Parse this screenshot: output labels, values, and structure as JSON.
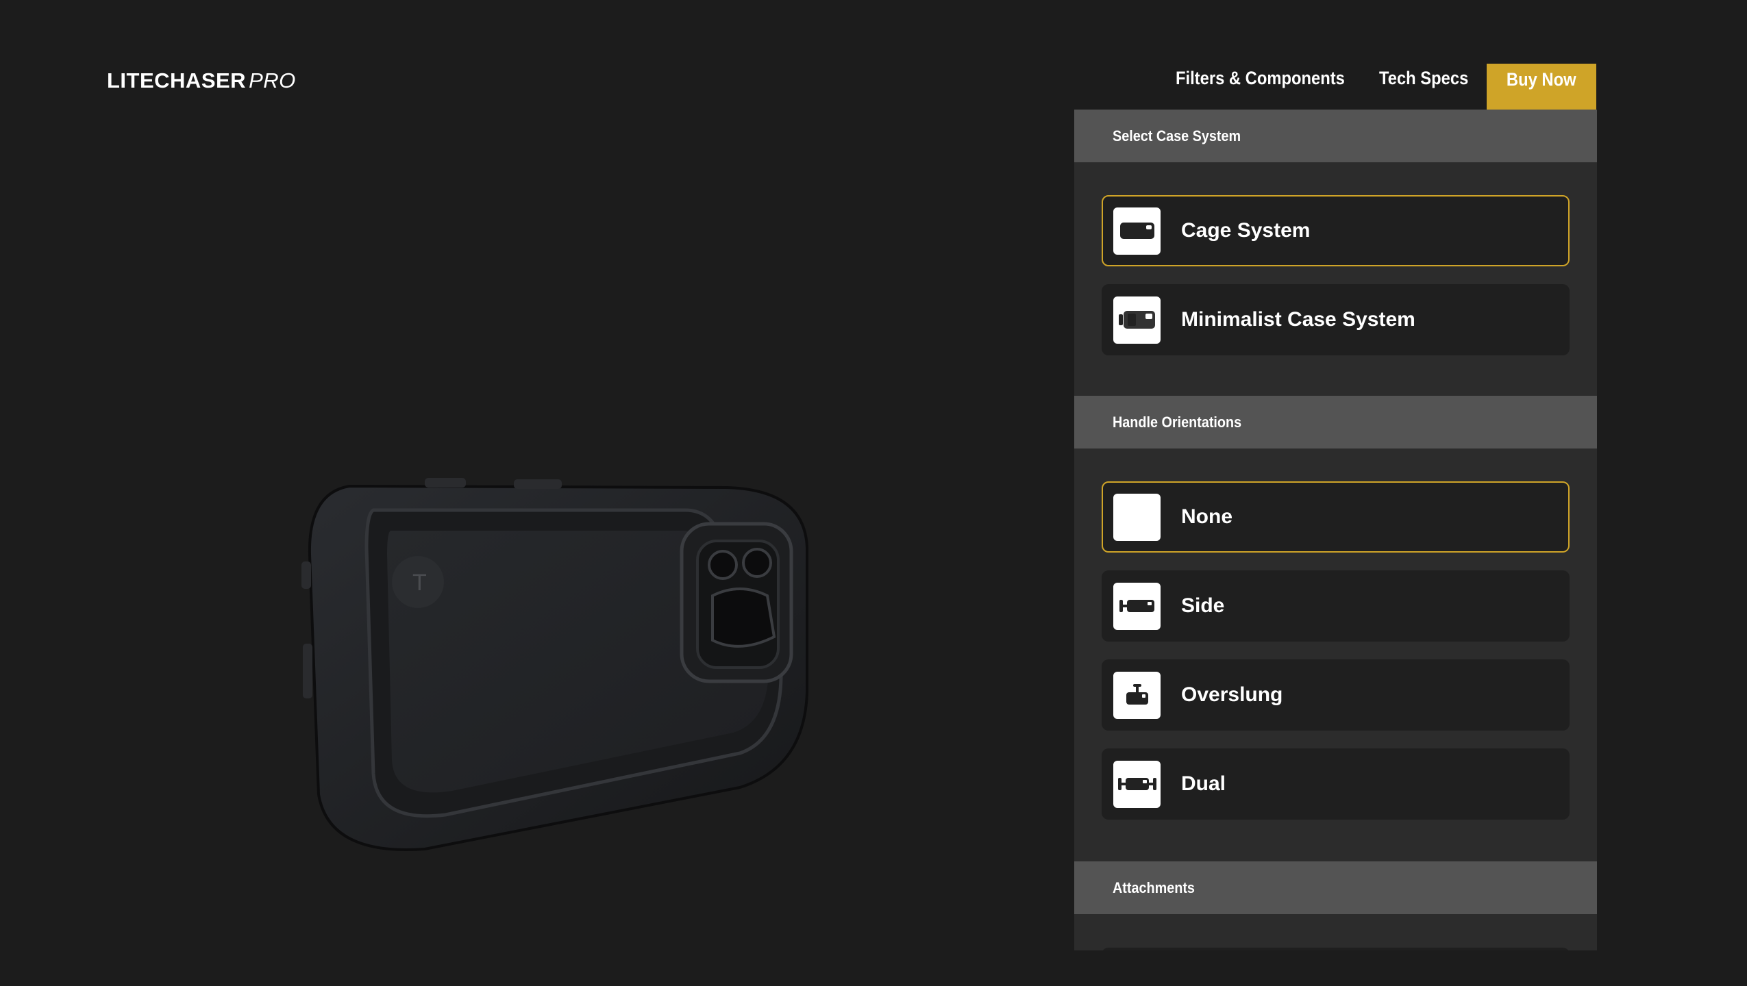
{
  "brand": {
    "name": "LITECHASER",
    "suffix": "PRO"
  },
  "nav": {
    "filters": "Filters & Components",
    "specs": "Tech Specs",
    "buy": "Buy Now"
  },
  "sections": {
    "case_system": {
      "title": "Select Case System",
      "options": [
        {
          "label": "Cage System",
          "icon": "cage-case-icon",
          "selected": true
        },
        {
          "label": "Minimalist Case System",
          "icon": "minimalist-case-icon",
          "selected": false
        }
      ]
    },
    "handle": {
      "title": "Handle Orientations",
      "options": [
        {
          "label": "None",
          "icon": "blank-icon",
          "selected": true
        },
        {
          "label": "Side",
          "icon": "side-handle-icon",
          "selected": false
        },
        {
          "label": "Overslung",
          "icon": "overslung-handle-icon",
          "selected": false
        },
        {
          "label": "Dual",
          "icon": "dual-handle-icon",
          "selected": false
        }
      ]
    },
    "attachments": {
      "title": "Attachments"
    }
  },
  "colors": {
    "accent": "#cfa428",
    "background": "#1c1c1c",
    "panel": "#2c2c2c",
    "section_header": "#545454",
    "option": "#1f1f1f"
  }
}
